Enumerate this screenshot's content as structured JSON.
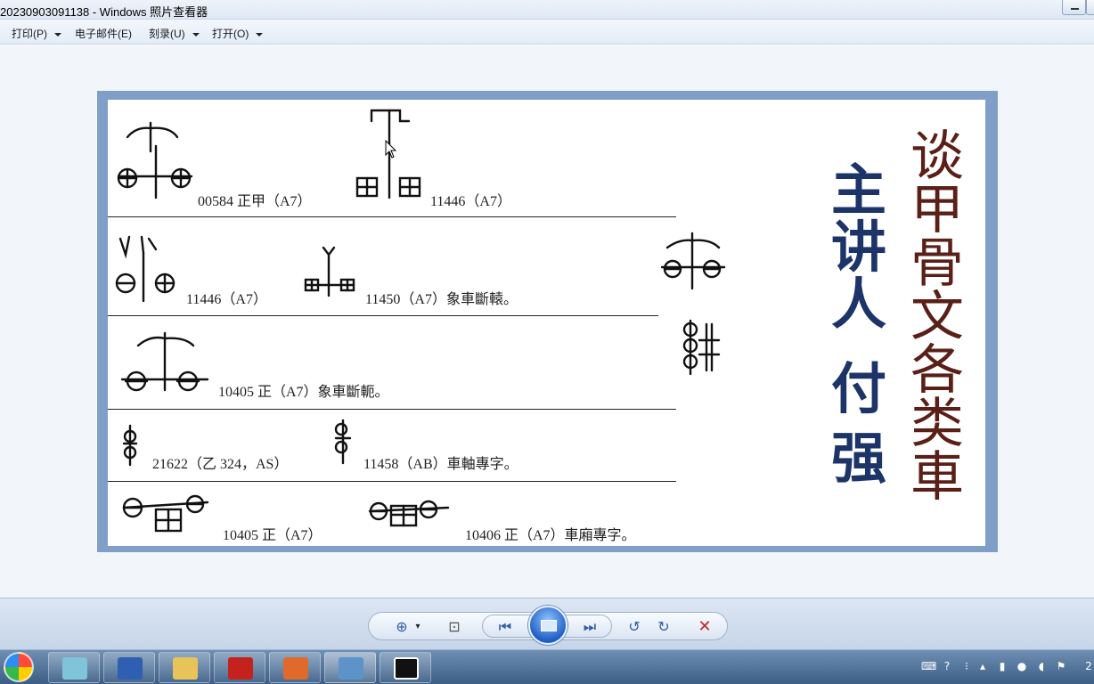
{
  "window": {
    "title": "20230903091138 - Windows 照片查看器"
  },
  "menu": {
    "print": "打印(P)",
    "email": "电子邮件(E)",
    "burn": "刻录(U)",
    "open": "打开(O)"
  },
  "photo": {
    "captions": {
      "c1": "00584 正甲（A7）",
      "c2": "11446（A7）",
      "c3": "11446（A7）",
      "c4": "11450（A7）象車斷轅。",
      "c5": "10405 正（A7）象車斷軛。",
      "c6": "21622（乙 324，AS）",
      "c7": "11458（AB）車軸專字。",
      "c8": "10405 正（A7）",
      "c9": "10406 正（A7）車廂專字。"
    },
    "title_vertical": "谈甲骨文各类車",
    "speaker_vertical": "主讲人",
    "name_vertical": "付强"
  },
  "controls": {
    "zoom": "zoom-icon",
    "fit": "fit-window-icon",
    "previous": "previous-icon",
    "slideshow": "slideshow-icon",
    "next": "next-icon",
    "rotate_ccw": "rotate-counterclockwise-icon",
    "rotate_cw": "rotate-clockwise-icon",
    "delete": "delete-icon"
  },
  "taskbar": {
    "apps": [
      "start-orb",
      "notepad-icon",
      "word-icon",
      "file-explorer-icon",
      "pdf-reader-icon",
      "powerpoint-icon",
      "photo-viewer-icon",
      "video-recorder-icon"
    ],
    "clock_partial": "2"
  },
  "colors": {
    "title_brown": "#5a1f16",
    "speaker_navy": "#1d3469",
    "frame_blue": "#7f9fc9"
  }
}
